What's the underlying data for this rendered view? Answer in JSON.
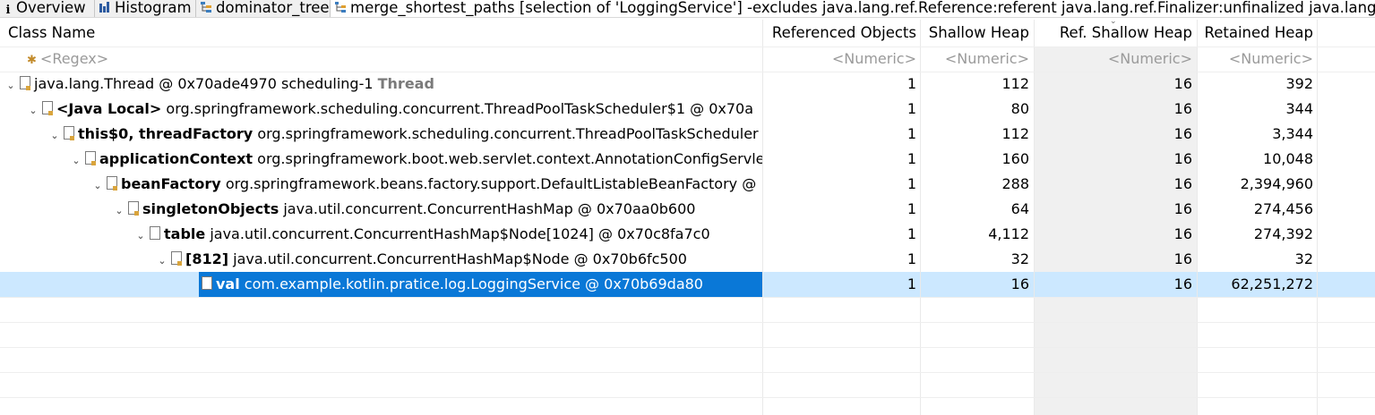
{
  "tabs": [
    {
      "label": "Overview",
      "icon": "info-icon"
    },
    {
      "label": "Histogram",
      "icon": "histogram-icon"
    },
    {
      "label": "dominator_tree",
      "icon": "dominator-tree-icon"
    },
    {
      "label": "merge_shortest_paths [selection of 'LoggingService'] -excludes java.lang.ref.Reference:referent java.lang.ref.Finalizer:unfinalized java.lang.Runt",
      "icon": "merge-paths-icon"
    }
  ],
  "columns": {
    "class_name": "Class Name",
    "referenced_objects": "Referenced Objects",
    "shallow_heap": "Shallow Heap",
    "ref_shallow_heap": "Ref. Shallow Heap",
    "retained_heap": "Retained Heap"
  },
  "filters": {
    "regex": "<Regex>",
    "numeric": "<Numeric>"
  },
  "rows": [
    {
      "name": "",
      "desc": "java.lang.Thread @ 0x70ade4970  scheduling-1 ",
      "tag": "Thread",
      "ref": "1",
      "shallow": "112",
      "refShallow": "16",
      "retained": "392"
    },
    {
      "name": "<Java Local>",
      "desc": " org.springframework.scheduling.concurrent.ThreadPoolTaskScheduler$1 @ 0x70a",
      "ref": "1",
      "shallow": "80",
      "refShallow": "16",
      "retained": "344"
    },
    {
      "name": "this$0, threadFactory",
      "desc": " org.springframework.scheduling.concurrent.ThreadPoolTaskScheduler",
      "ref": "1",
      "shallow": "112",
      "refShallow": "16",
      "retained": "3,344"
    },
    {
      "name": "applicationContext",
      "desc": " org.springframework.boot.web.servlet.context.AnnotationConfigServle",
      "ref": "1",
      "shallow": "160",
      "refShallow": "16",
      "retained": "10,048"
    },
    {
      "name": "beanFactory",
      "desc": " org.springframework.beans.factory.support.DefaultListableBeanFactory @",
      "ref": "1",
      "shallow": "288",
      "refShallow": "16",
      "retained": "2,394,960"
    },
    {
      "name": "singletonObjects",
      "desc": " java.util.concurrent.ConcurrentHashMap @ 0x70aa0b600",
      "ref": "1",
      "shallow": "64",
      "refShallow": "16",
      "retained": "274,456"
    },
    {
      "name": "table",
      "desc": " java.util.concurrent.ConcurrentHashMap$Node[1024] @ 0x70c8fa7c0",
      "ref": "1",
      "shallow": "4,112",
      "refShallow": "16",
      "retained": "274,392"
    },
    {
      "name": "[812]",
      "desc": " java.util.concurrent.ConcurrentHashMap$Node @ 0x70b6fc500",
      "ref": "1",
      "shallow": "32",
      "refShallow": "16",
      "retained": "32"
    },
    {
      "name": "val",
      "desc": " com.example.kotlin.pratice.log.LoggingService @ 0x70b69da80",
      "ref": "1",
      "shallow": "16",
      "refShallow": "16",
      "retained": "62,251,272"
    }
  ],
  "colors": {
    "selection": "#0a78d7",
    "selection_row": "#cce8ff",
    "sorted_column": "#f0f0f0"
  }
}
